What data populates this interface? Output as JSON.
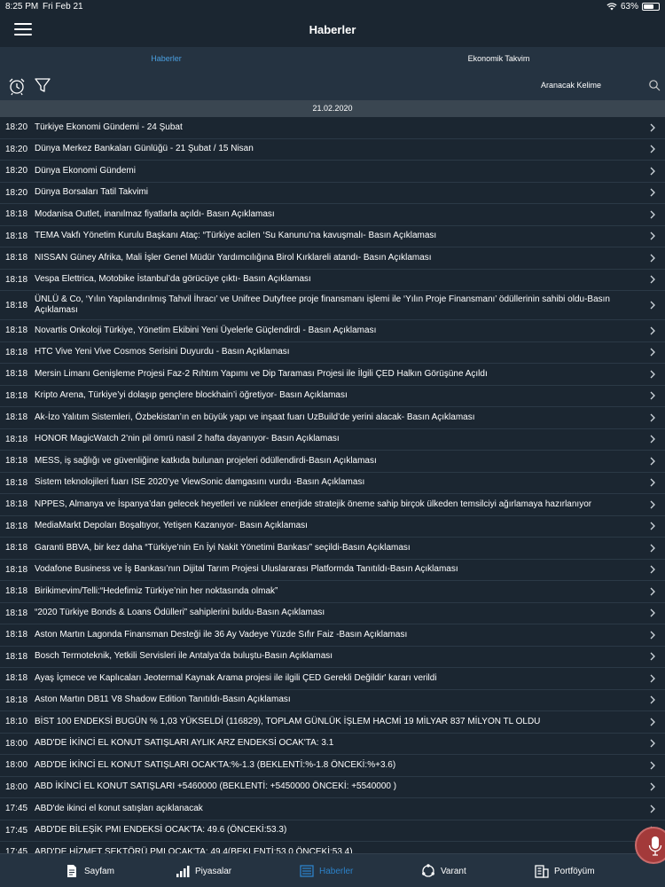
{
  "status": {
    "time": "8:25 PM",
    "date": "Fri Feb 21",
    "battery": "63%",
    "battery_level": 0.63
  },
  "header": {
    "title": "Haberler"
  },
  "tabs": [
    {
      "label": "Haberler",
      "active": true
    },
    {
      "label": "Ekonomik Takvim",
      "active": false
    }
  ],
  "search": {
    "placeholder": "Aranacak Kelime"
  },
  "date_header": "21.02.2020",
  "news": [
    {
      "time": "18:20",
      "title": "Türkiye Ekonomi Gündemi - 24 Şubat"
    },
    {
      "time": "18:20",
      "title": "Dünya Merkez Bankaları Günlüğü - 21 Şubat / 15 Nisan"
    },
    {
      "time": "18:20",
      "title": "Dünya Ekonomi Gündemi"
    },
    {
      "time": "18:20",
      "title": "Dünya Borsaları Tatil Takvimi"
    },
    {
      "time": "18:18",
      "title": "Modanisa Outlet, inanılmaz fiyatlarla açıldı- Basın Açıklaması"
    },
    {
      "time": "18:18",
      "title": "TEMA Vakfı Yönetim Kurulu Başkanı Ataç:  “Türkiye acilen ‘Su Kanunu’na kavuşmalı- Basın Açıklaması"
    },
    {
      "time": "18:18",
      "title": "NISSAN Güney Afrika, Mali İşler Genel Müdür Yardımcılığına Birol Kırklareli atandı- Basın Açıklaması"
    },
    {
      "time": "18:18",
      "title": "Vespa Elettrica, Motobike İstanbul’da görücüye çıktı- Basın Açıklaması"
    },
    {
      "time": "18:18",
      "title": "ÜNLÜ & Co, ‘Yılın Yapılandırılmış Tahvil İhracı’ ve Unifree Dutyfree proje finansmanı işlemi ile ‘Yılın Proje Finansmanı’ ödüllerinin sahibi oldu-Basın Açıklaması"
    },
    {
      "time": "18:18",
      "title": "Novartis Onkoloji Türkiye,  Yönetim Ekibini Yeni Üyelerle Güçlendirdi - Basın Açıklaması"
    },
    {
      "time": "18:18",
      "title": "HTC Vive Yeni Vive Cosmos Serisini Duyurdu - Basın Açıklaması"
    },
    {
      "time": "18:18",
      "title": "Mersin Limanı Genişleme Projesi Faz-2 Rıhtım Yapımı ve Dip Taraması Projesi ile İlgili ÇED Halkın Görüşüne Açıldı"
    },
    {
      "time": "18:18",
      "title": "Kripto Arena, Türkiye’yi dolaşıp gençlere blockhain’i öğretiyor- Basın Açıklaması"
    },
    {
      "time": "18:18",
      "title": "Ak-İzo Yalıtım Sistemleri, Özbekistan’ın en büyük yapı ve inşaat fuarı UzBuild’de yerini alacak- Basın Açıklaması"
    },
    {
      "time": "18:18",
      "title": "HONOR MagicWatch 2’nin pil ömrü nasıl 2 hafta dayanıyor- Basın Açıklaması"
    },
    {
      "time": "18:18",
      "title": "MESS, iş sağlığı ve güvenliğine katkıda bulunan projeleri ödüllendirdi-Basın Açıklaması"
    },
    {
      "time": "18:18",
      "title": "Sistem teknolojileri fuarı ISE 2020’ye ViewSonic damgasını vurdu -Basın Açıklaması"
    },
    {
      "time": "18:18",
      "title": "NPPES, Almanya ve İspanya’dan gelecek heyetleri ve nükleer enerjide stratejik öneme sahip birçok ülkeden temsilciyi ağırlamaya hazırlanıyor"
    },
    {
      "time": "18:18",
      "title": "MediaMarkt Depoları Boşaltıyor, Yetişen Kazanıyor- Basın Açıklaması"
    },
    {
      "time": "18:18",
      "title": "Garanti BBVA, bir kez daha “Türkiye’nin En İyi Nakit Yönetimi Bankası” seçildi-Basın Açıklaması"
    },
    {
      "time": "18:18",
      "title": "Vodafone Business ve İş Bankası’nın Dijital Tarım Projesi Uluslararası Platformda Tanıtıldı-Basın Açıklaması"
    },
    {
      "time": "18:18",
      "title": "Birikimevim/Telli:“Hedefimiz Türkiye’nin her noktasında olmak”"
    },
    {
      "time": "18:18",
      "title": "“2020 Türkiye Bonds & Loans Ödülleri” sahiplerini buldu-Basın Açıklaması"
    },
    {
      "time": "18:18",
      "title": "Aston Martın Lagonda Finansman Desteği ile 36 Ay Vadeye Yüzde Sıfır Faiz  -Basın Açıklaması"
    },
    {
      "time": "18:18",
      "title": "Bosch Termoteknik, Yetkili Servisleri ile Antalya’da buluştu-Basın Açıklaması"
    },
    {
      "time": "18:18",
      "title": "Ayaş İçmece ve Kaplıcaları Jeotermal Kaynak Arama projesi ile ilgili ÇED Gerekli Değildir' kararı verildi"
    },
    {
      "time": "18:18",
      "title": "Aston Martın DB11 V8 Shadow Edition Tanıtıldı-Basın Açıklaması"
    },
    {
      "time": "18:10",
      "title": "BİST 100 ENDEKSİ BUGÜN % 1,03 YÜKSELDİ (116829), TOPLAM GÜNLÜK İŞLEM HACMİ 19  MİLYAR 837  MİLYON TL OLDU"
    },
    {
      "time": "18:00",
      "title": "ABD'DE İKİNCİ EL KONUT SATIŞLARI AYLIK ARZ ENDEKSİ OCAK'TA:  3.1"
    },
    {
      "time": "18:00",
      "title": "ABD'DE İKİNCİ EL KONUT SATIŞLARI OCAK'TA:%-1.3  (BEKLENTİ:%-1.8 ÖNCEKİ:%+3.6)"
    },
    {
      "time": "18:00",
      "title": "ABD İKİNCİ EL KONUT SATIŞLARI +5460000  (BEKLENTİ: +5450000  ÖNCEKİ: +5540000 )"
    },
    {
      "time": "17:45",
      "title": "ABD'de ikinci el konut satışları açıklanacak"
    },
    {
      "time": "17:45",
      "title": "ABD'DE BİLEŞİK PMI ENDEKSİ OCAK'TA: 49.6 (ÖNCEKİ:53.3)"
    },
    {
      "time": "17:45",
      "title": "ABD'DE HİZMET SEKTÖRÜ PMI OCAK'TA: 49.4(BEKLENTİ:53.0 ÖNCEKİ:53.4)"
    }
  ],
  "bottom_tabs": [
    {
      "label": "Sayfam",
      "icon": "document-icon",
      "active": false
    },
    {
      "label": "Piyasalar",
      "icon": "chart-icon",
      "active": false
    },
    {
      "label": "Haberler",
      "icon": "news-icon",
      "active": true
    },
    {
      "label": "Varant",
      "icon": "cycle-icon",
      "active": false
    },
    {
      "label": "Portföyüm",
      "icon": "building-icon",
      "active": false
    }
  ],
  "colors": {
    "background": "#1b2631",
    "panel": "#253341",
    "accent": "#2c82c9",
    "mic": "#a33a3a"
  }
}
